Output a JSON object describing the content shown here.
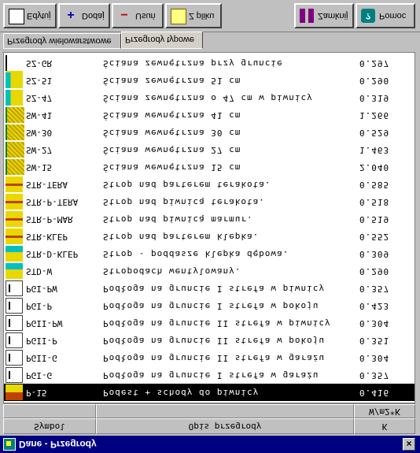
{
  "window": {
    "title": "Dane - Przegrody"
  },
  "toolbar": {
    "edit_label": "Edytuj",
    "add_label": "Dodaj",
    "delete_label": "Usuń",
    "from_file_label": "Z pliku",
    "close_label": "Zamknij",
    "help_label": "Pomoc"
  },
  "tabs": [
    {
      "label": "Przegrody wielowarstwowe"
    },
    {
      "label": "Przegrody typowe"
    }
  ],
  "table": {
    "headers": {
      "symbol": "Symbol",
      "description": "Opis przegrody",
      "k": "K",
      "unit": "W/m2*K"
    },
    "rows": [
      {
        "symbol": "SZ-GR",
        "description": "Ściana zewnętrzna przy gruncie",
        "value": "0.297",
        "icon": "wall-ground-icon"
      },
      {
        "symbol": "SZ-51",
        "description": "Ściana zewnętrzna 51 cm",
        "value": "0.290",
        "icon": "wall-ext-icon"
      },
      {
        "symbol": "SZ-47",
        "description": "Ściana zewnętrzna o 47 cm w piwnicy",
        "value": "0.319",
        "icon": "wall-ext-icon"
      },
      {
        "symbol": "SW-41",
        "description": "Ściana wewnętrzna 41 cm",
        "value": "1.266",
        "icon": "wall-int-icon"
      },
      {
        "symbol": "SW-30",
        "description": "Ściana wewnętrzna 30 cm",
        "value": "0.529",
        "icon": "wall-int-icon"
      },
      {
        "symbol": "SW-27",
        "description": "Ściana wewnętrzna 27 cm",
        "value": "1.463",
        "icon": "wall-int-icon"
      },
      {
        "symbol": "SW-15",
        "description": "Ściana wewnętrzna 15 cm",
        "value": "2.040",
        "icon": "wall-int-icon"
      },
      {
        "symbol": "STR-TERA",
        "description": "Strop nad parterem terakota.",
        "value": "0.585",
        "icon": "ceiling-icon"
      },
      {
        "symbol": "STR-P-TERA",
        "description": "Strop nad piwnicą terakota.",
        "value": "0.518",
        "icon": "ceiling-icon"
      },
      {
        "symbol": "STR-P-MAR",
        "description": "Strop nad piwnicą marmur.",
        "value": "0.519",
        "icon": "ceiling-icon"
      },
      {
        "symbol": "STR-KLEP",
        "description": "Strop nad parterem klepka.",
        "value": "0.552",
        "icon": "ceiling-icon"
      },
      {
        "symbol": "STR-D-KLEP",
        "description": "Strop - poddasze klepka dębowa.",
        "value": "0.309",
        "icon": "ceiling-attic-icon"
      },
      {
        "symbol": "STD-W",
        "description": "Stropodach wentylowany.",
        "value": "0.290",
        "icon": "roof-icon"
      },
      {
        "symbol": "PGI-PW",
        "description": "Podłoga na gruncie I strefa w piwnicy",
        "value": "0.357",
        "icon": "floor-icon"
      },
      {
        "symbol": "PGI-P",
        "description": "Podłoga na gruncie I strefa w pokoju",
        "value": "0.423",
        "icon": "floor-icon"
      },
      {
        "symbol": "PGII-PW",
        "description": "Podłoga na gruncie II strefa w piwnicy",
        "value": "0.304",
        "icon": "floor-icon"
      },
      {
        "symbol": "PGII-P",
        "description": "Podłoga na gruncie II strefa w pokoju",
        "value": "0.351",
        "icon": "floor-icon"
      },
      {
        "symbol": "PGII-G",
        "description": "Podłoga na gruncie II strefa w garażu",
        "value": "0.304",
        "icon": "floor-icon"
      },
      {
        "symbol": "PGI-G",
        "description": "Podłoga na gruncie I strefa w garażu",
        "value": "0.357",
        "icon": "floor-icon"
      },
      {
        "symbol": "P-15",
        "description": "Podest + schody do piwnicy",
        "value": "0.416",
        "icon": "stairs-icon",
        "selected": true
      }
    ]
  },
  "colors": {
    "title_bar": "#000080",
    "selection": "#000000",
    "face": "#c0c0c0"
  }
}
